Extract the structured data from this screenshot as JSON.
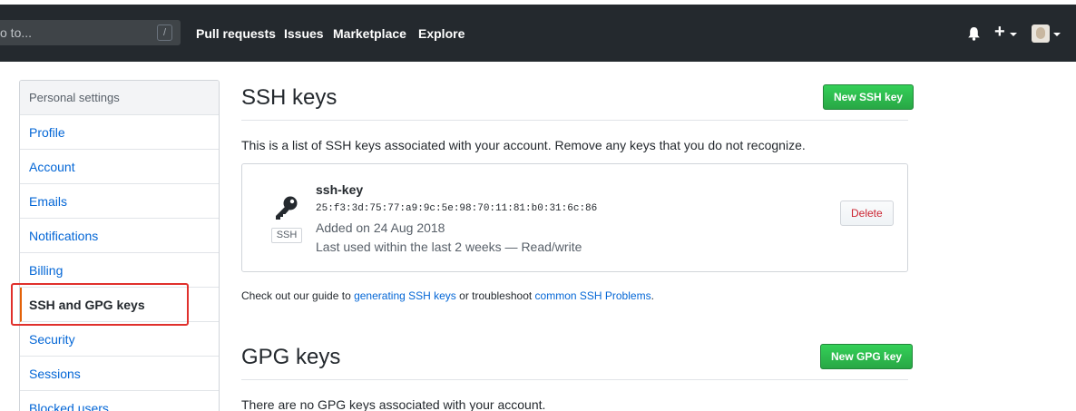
{
  "header": {
    "search_placeholder": "o to...",
    "search_shortcut": "/",
    "nav": [
      "Pull requests",
      "Issues",
      "Marketplace",
      "Explore"
    ]
  },
  "sidebar": {
    "heading": "Personal settings",
    "items": [
      {
        "label": "Profile"
      },
      {
        "label": "Account"
      },
      {
        "label": "Emails"
      },
      {
        "label": "Notifications"
      },
      {
        "label": "Billing"
      },
      {
        "label": "SSH and GPG keys",
        "active": true
      },
      {
        "label": "Security"
      },
      {
        "label": "Sessions"
      },
      {
        "label": "Blocked users"
      }
    ]
  },
  "ssh": {
    "title": "SSH keys",
    "new_button": "New SSH key",
    "description": "This is a list of SSH keys associated with your account. Remove any keys that you do not recognize.",
    "key": {
      "type_badge": "SSH",
      "name": "ssh-key",
      "fingerprint": "25:f3:3d:75:77:a9:9c:5e:98:70:11:81:b0:31:6c:86",
      "added": "Added on 24 Aug 2018",
      "last_used": "Last used within the last 2 weeks — Read/write",
      "delete_button": "Delete"
    },
    "help": {
      "prefix": "Check out our guide to ",
      "link1": "generating SSH keys",
      "middle": " or troubleshoot ",
      "link2": "common SSH Problems",
      "suffix": "."
    }
  },
  "gpg": {
    "title": "GPG keys",
    "new_button": "New GPG key",
    "description": "There are no GPG keys associated with your account."
  },
  "colors": {
    "header_bg": "#24292e",
    "link": "#0366d6",
    "primary_button": "#28a745",
    "danger": "#cb2431",
    "highlight_box": "#e0302c"
  }
}
